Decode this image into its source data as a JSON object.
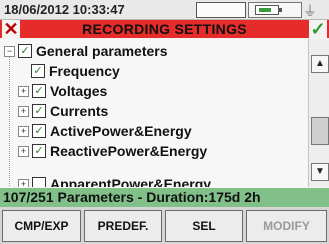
{
  "status_bar": {
    "datetime": "18/06/2012 10:33:47"
  },
  "title_bar": {
    "title": "RECORDING SETTINGS",
    "cancel_icon": "x-icon",
    "confirm_icon": "checkmark-icon"
  },
  "tree": {
    "items": [
      {
        "label": "General parameters",
        "expander": "−",
        "checked": true
      },
      {
        "label": "Frequency",
        "expander": "",
        "checked": true
      },
      {
        "label": "Voltages",
        "expander": "+",
        "checked": true
      },
      {
        "label": "Currents",
        "expander": "+",
        "checked": true
      },
      {
        "label": "ActivePower&Energy",
        "expander": "+",
        "checked": true
      },
      {
        "label": "ReactivePower&Energy",
        "expander": "+",
        "checked": true
      },
      {
        "label": "ApparentPower&Energy",
        "expander": "+",
        "checked": false
      }
    ]
  },
  "info_bar": {
    "text": "107/251 Parameters - Duration:175d 2h"
  },
  "buttons": {
    "b1": "CMP/EXP",
    "b2": "PREDEF.",
    "b3": "SEL",
    "b4": "MODIFY"
  },
  "colors": {
    "title_bg": "#e62b2b",
    "info_bg": "#82c08a",
    "check": "#2e7d2e"
  }
}
